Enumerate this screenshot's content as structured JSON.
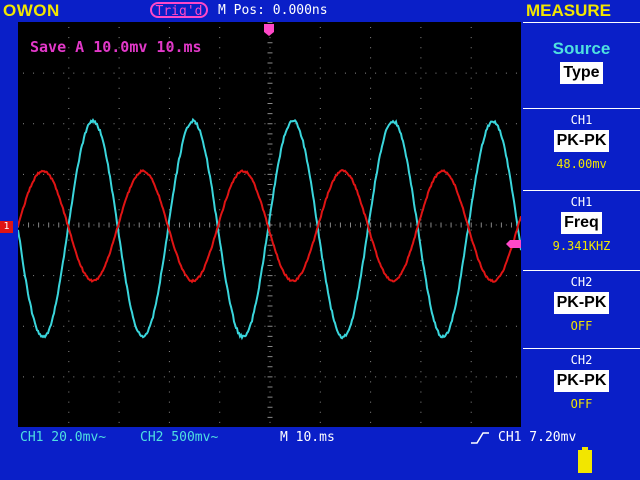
{
  "header": {
    "brand": "OWON",
    "trigger_status": "Trig'd",
    "m_pos": "M Pos: 0.000ns",
    "menu_title": "MEASURE"
  },
  "screen": {
    "save_label": "Save A 10.0mv 10.ms",
    "ch1_marker": "1"
  },
  "colors": {
    "ch1": "#e01414",
    "ch2": "#3ad6dc",
    "accent": "#f2e600",
    "background": "#0a1fc8"
  },
  "menu": {
    "source_title": "Source",
    "source_button": "Type",
    "slots": [
      {
        "channel": "CH1",
        "type": "PK-PK",
        "value": "48.00mv"
      },
      {
        "channel": "CH1",
        "type": "Freq",
        "value": "9.341KHZ"
      },
      {
        "channel": "CH2",
        "type": "PK-PK",
        "value": "OFF"
      },
      {
        "channel": "CH2",
        "type": "PK-PK",
        "value": "OFF"
      }
    ]
  },
  "status": {
    "ch1_scale": "CH1 20.0mv~",
    "ch2_scale": "CH2 500mv~",
    "timebase": "M 10.ms",
    "trigger": "CH1 7.20mv"
  }
}
